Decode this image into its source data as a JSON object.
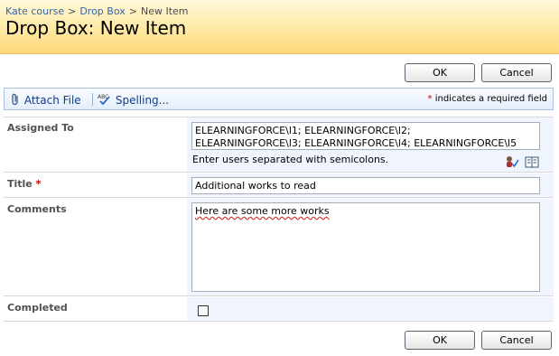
{
  "breadcrumb": {
    "items": [
      "Kate course",
      "Drop Box",
      "New Item"
    ],
    "separator": ">"
  },
  "page_title": "Drop Box: New Item",
  "buttons": {
    "ok": "OK",
    "cancel": "Cancel"
  },
  "toolbar": {
    "attach_file": "Attach File",
    "spelling": "Spelling...",
    "required_star": "*",
    "required_note": "indicates a required field"
  },
  "fields": {
    "assigned_to": {
      "label": "Assigned To",
      "line1": "ELEARNINGFORCE\\l1; ELEARNINGFORCE\\l2;",
      "line2": "ELEARNINGFORCE\\l3; ELEARNINGFORCE\\l4; ELEARNINGFORCE\\l5",
      "hint": "Enter users separated with semicolons."
    },
    "title": {
      "label": "Title",
      "required_star": "*",
      "value": "Additional works to read"
    },
    "comments": {
      "label": "Comments",
      "value": "Here are some more works"
    },
    "completed": {
      "label": "Completed",
      "checked": false
    }
  },
  "colors": {
    "header_bg": "#ffe9a3",
    "field_bg": "#f0f5fd",
    "link": "#3366aa",
    "required": "#cc0000"
  }
}
